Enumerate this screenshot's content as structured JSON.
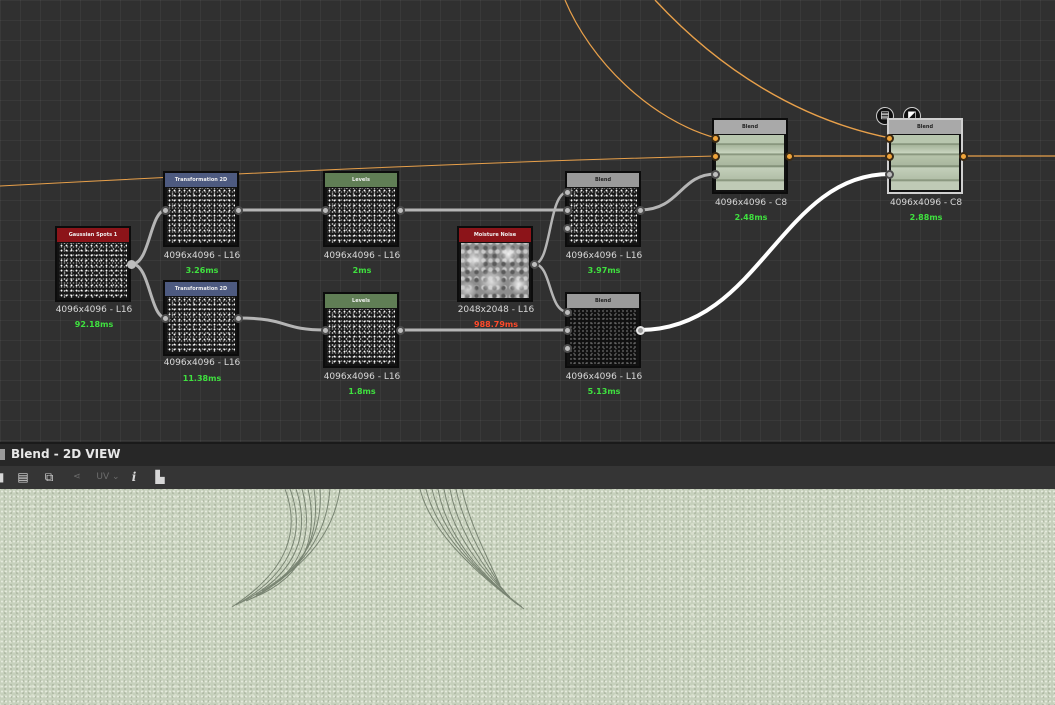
{
  "nodes": [
    {
      "id": "gaussian",
      "title": "Gaussian Spots 1",
      "size": "4096x4096 - L16",
      "time": "92.18ms"
    },
    {
      "id": "transform1",
      "title": "Transformation 2D",
      "size": "4096x4096 - L16",
      "time": "3.26ms"
    },
    {
      "id": "transform2",
      "title": "Transformation 2D",
      "size": "4096x4096 - L16",
      "time": "11.38ms"
    },
    {
      "id": "levels1",
      "title": "Levels",
      "size": "4096x4096 - L16",
      "time": "2ms"
    },
    {
      "id": "levels2",
      "title": "Levels",
      "size": "4096x4096 - L16",
      "time": "1.8ms"
    },
    {
      "id": "moisture",
      "title": "Moisture Noise",
      "size": "2048x2048 - L16",
      "time": "988.79ms"
    },
    {
      "id": "blend1",
      "title": "Blend",
      "size": "4096x4096 - L16",
      "time": "3.97ms"
    },
    {
      "id": "blend2",
      "title": "Blend",
      "size": "4096x4096 - L16",
      "time": "5.13ms"
    },
    {
      "id": "blend3",
      "title": "Blend",
      "size": "4096x4096 - C8",
      "time": "2.48ms"
    },
    {
      "id": "blend4",
      "title": "Blend",
      "size": "4096x4096 - C8",
      "time": "2.88ms"
    }
  ],
  "colors": {
    "time_ok": "#3fe13f",
    "time_slow": "#ff4a2a",
    "wire_color": "#e8a04a",
    "wire_gray": "#b5b5b5"
  },
  "panel": {
    "title": "Blend - 2D VIEW"
  },
  "toolbar": {
    "items": [
      {
        "name": "save-icon",
        "glyph": "▤"
      },
      {
        "name": "copy-icon",
        "glyph": "⧉"
      },
      {
        "name": "share-icon",
        "glyph": "⋖"
      },
      {
        "name": "uv-dropdown",
        "glyph": "UV ⌄"
      },
      {
        "name": "info-icon",
        "glyph": "i"
      },
      {
        "name": "histogram-icon",
        "glyph": "▙"
      }
    ]
  }
}
